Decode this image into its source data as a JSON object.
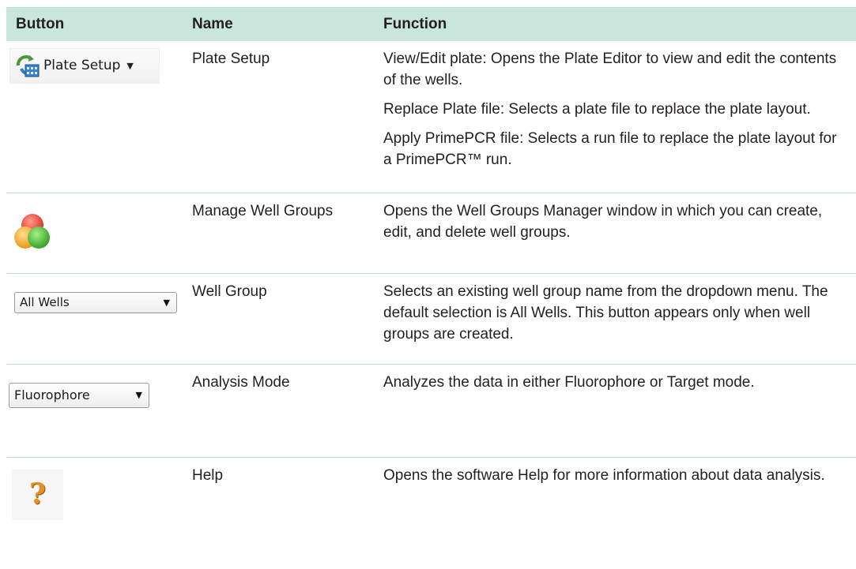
{
  "table": {
    "headers": {
      "button": "Button",
      "name": "Name",
      "function": "Function"
    },
    "rows": [
      {
        "button_label": "Plate Setup",
        "name": "Plate Setup",
        "function_paras": [
          "View/Edit plate: Opens the Plate Editor to view and edit the contents of the wells.",
          "Replace Plate file: Selects a plate file to replace the plate layout.",
          "Apply PrimePCR file: Selects a run file to replace the plate layout for a PrimePCR™ run."
        ]
      },
      {
        "button_label": "",
        "name": "Manage Well Groups",
        "function_paras": [
          "Opens the Well Groups Manager window in which you can create, edit, and delete well groups."
        ]
      },
      {
        "button_label": "All Wells",
        "name": "Well Group",
        "function_paras": [
          "Selects an existing well group name from the dropdown menu. The default selection is All Wells. This button appears only when well groups are created."
        ]
      },
      {
        "button_label": "Fluorophore",
        "name": "Analysis Mode",
        "function_paras": [
          "Analyzes the data in either Fluorophore or Target mode."
        ]
      },
      {
        "button_label": "?",
        "name": "Help",
        "function_paras": [
          "Opens the software Help for more information about data analysis."
        ]
      }
    ]
  },
  "icons": {
    "plate_setup": "plate-setup-icon",
    "manage_groups": "well-groups-icon",
    "help": "help-icon"
  },
  "colors": {
    "header_bg": "#c8e6dc",
    "rule": "#b9dfd2",
    "text": "#231f20",
    "help_orange": "#e39124"
  }
}
